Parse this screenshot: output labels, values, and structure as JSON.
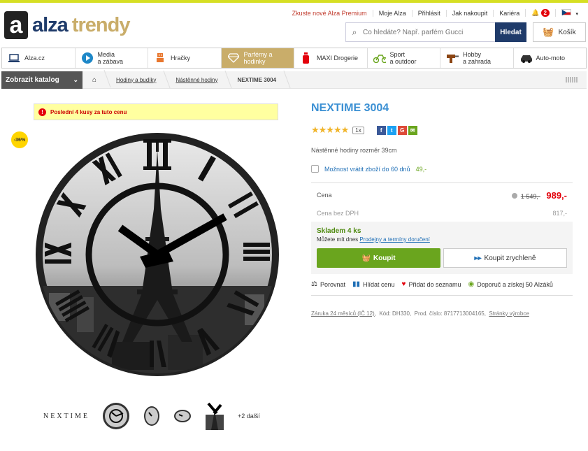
{
  "logo": {
    "mark": "a",
    "alza": "alza",
    "trendy": "trendy"
  },
  "toplinks": [
    "Zkuste nové Alza Premium",
    "Moje Alza",
    "Přihlásit",
    "Jak nakoupit",
    "Kariéra"
  ],
  "notifications": "2",
  "search": {
    "placeholder": "Co hledáte? Např. parfém Gucci",
    "button": "Hledat"
  },
  "cart": "Košík",
  "categories": [
    {
      "label1": "Alza.cz",
      "label2": "",
      "icon": "laptop-icon"
    },
    {
      "label1": "Media",
      "label2": "a zábava",
      "icon": "play-icon"
    },
    {
      "label1": "Hračky",
      "label2": "",
      "icon": "robot-icon"
    },
    {
      "label1": "Parfémy a",
      "label2": "hodinky",
      "icon": "diamond-icon",
      "active": true
    },
    {
      "label1": "MAXI Drogerie",
      "label2": "",
      "icon": "spray-icon"
    },
    {
      "label1": "Sport",
      "label2": "a outdoor",
      "icon": "bike-icon"
    },
    {
      "label1": "Hobby",
      "label2": "a zahrada",
      "icon": "drill-icon"
    },
    {
      "label1": "Auto-moto",
      "label2": "",
      "icon": "car-icon"
    }
  ],
  "catalog": "Zobrazit katalog",
  "breadcrumb": [
    "Hodiny a budíky",
    "Nástěnné hodiny",
    "NEXTIME 3004"
  ],
  "warning": "Poslední 4 kusy za tuto cenu",
  "discount": "-36%",
  "product": {
    "title": "NEXTIME 3004",
    "rating_count": "1x",
    "rating": 5,
    "description": "Nástěnné hodiny rozměr 39cm",
    "return_label": "Možnost vrátit zboží do 60 dnů",
    "return_price": "49,-",
    "price_label": "Cena",
    "old_price": "1 549,-",
    "price": "989,-",
    "price_novat_label": "Cena bez DPH",
    "price_novat": "817,-",
    "stock": "Skladem 4 ks",
    "delivery_prefix": "Můžete mít dnes",
    "delivery_link": "Prodejny a termíny doručení",
    "buy": "Koupit",
    "quick_buy": "Koupit zrychleně"
  },
  "actions": [
    "Porovnat",
    "Hlídat cenu",
    "Přidat do seznamu",
    "Doporuč a získej 50 Alzáků"
  ],
  "meta": {
    "warranty": "Záruka 24 měsíců (IČ 12)",
    "code": "Kód: DH330,",
    "part": "Prod. číslo: 8717713004165,",
    "pages": "Stránky výrobce"
  },
  "thumbs": {
    "brand": "NEXTIME",
    "more": "+2 další"
  },
  "colors": {
    "accent": "#c9ad6a",
    "title": "#3a8fd3",
    "buy": "#6aa51e",
    "price": "#e3000b"
  }
}
